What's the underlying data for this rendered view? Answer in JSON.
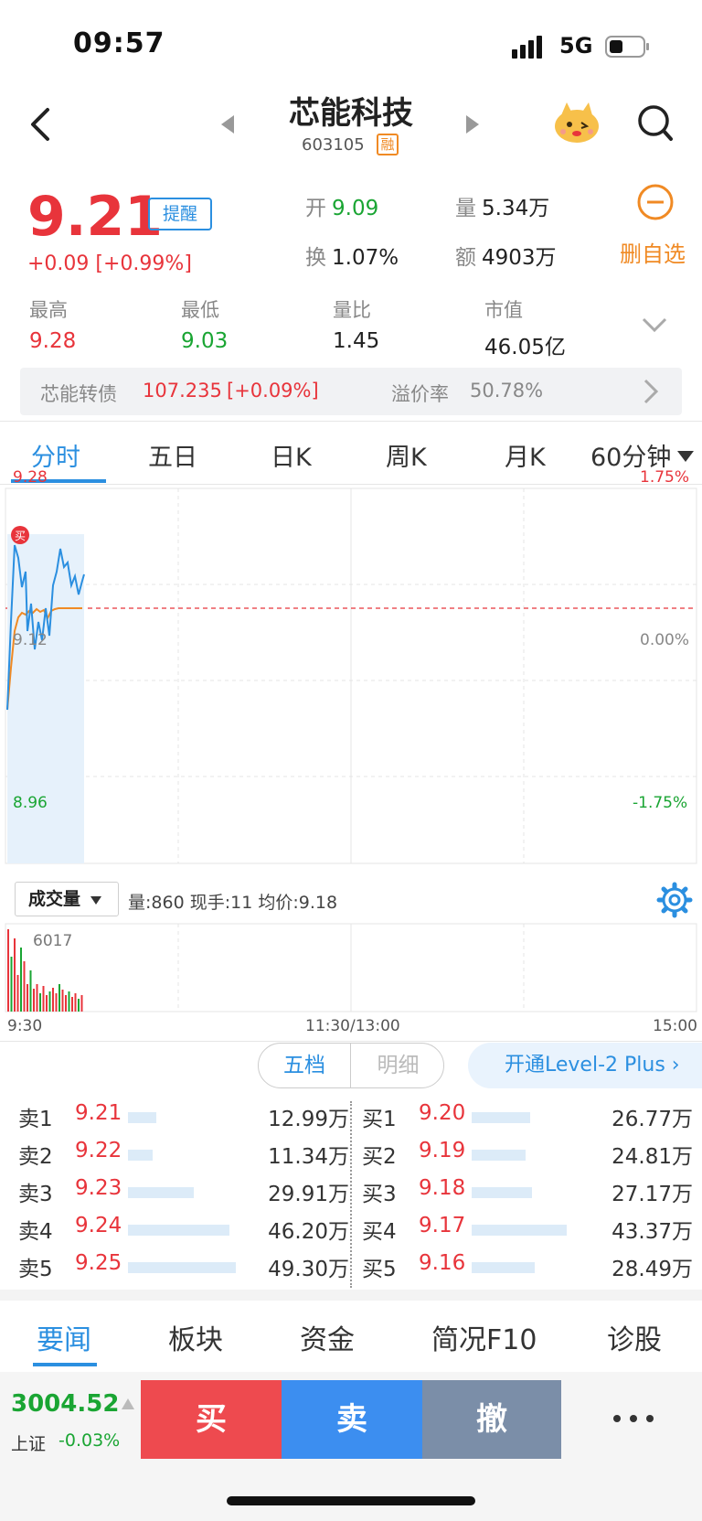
{
  "status_bar": {
    "time": "09:57",
    "network": "5G"
  },
  "header": {
    "stock_name": "芯能科技",
    "stock_code": "603105",
    "margin_tag": "融"
  },
  "quote": {
    "price": "9.21",
    "alert_label": "提醒",
    "change": "+0.09  [+0.99%]",
    "open_label": "开",
    "open_value": "9.09",
    "volume_label": "量",
    "volume_value": "5.34万",
    "turnover_label": "换",
    "turnover_value": "1.07%",
    "amount_label": "额",
    "amount_value": "4903万",
    "watchlist_remove_label": "删自选"
  },
  "stats": [
    {
      "label": "最高",
      "value": "9.28",
      "color": "#e8343b"
    },
    {
      "label": "最低",
      "value": "9.03",
      "color": "#1aa533"
    },
    {
      "label": "量比",
      "value": "1.45",
      "color": "#222222"
    },
    {
      "label": "市值",
      "value": "46.05亿",
      "color": "#222222"
    }
  ],
  "bond": {
    "name": "芯能转债",
    "price": "107.235",
    "change": "[+0.09%]",
    "premium_label": "溢价率",
    "premium_value": "50.78%"
  },
  "period_tabs": [
    "分时",
    "五日",
    "日K",
    "周K",
    "月K",
    "60分钟"
  ],
  "chart": {
    "y_max": "9.28",
    "y_mid": "9.12",
    "y_min": "8.96",
    "pct_max": "1.75%",
    "pct_mid": "0.00%",
    "pct_min": "-1.75%",
    "buy_marker": "买"
  },
  "chart_data": {
    "type": "line",
    "ylim": [
      8.96,
      9.28
    ],
    "reference_price": 9.12,
    "series": [],
    "volume_max_label": "6017"
  },
  "volume_panel": {
    "selector_label": "成交量",
    "info": "量:860  现手:11  均价:9.18"
  },
  "time_axis": {
    "start": "9:30",
    "mid": "11:30/13:00",
    "end": "15:00"
  },
  "depth": {
    "seg_five": "五档",
    "seg_detail": "明细",
    "level2": "开通Level-2 Plus",
    "asks": [
      {
        "label": "卖1",
        "price": "9.21",
        "volume": "12.99万",
        "ratio": 0.26
      },
      {
        "label": "卖2",
        "price": "9.22",
        "volume": "11.34万",
        "ratio": 0.23
      },
      {
        "label": "卖3",
        "price": "9.23",
        "volume": "29.91万",
        "ratio": 0.61
      },
      {
        "label": "卖4",
        "price": "9.24",
        "volume": "46.20万",
        "ratio": 0.94
      },
      {
        "label": "卖5",
        "price": "9.25",
        "volume": "49.30万",
        "ratio": 1.0
      }
    ],
    "bids": [
      {
        "label": "买1",
        "price": "9.20",
        "volume": "26.77万",
        "ratio": 0.62
      },
      {
        "label": "买2",
        "price": "9.19",
        "volume": "24.81万",
        "ratio": 0.57
      },
      {
        "label": "买3",
        "price": "9.18",
        "volume": "27.17万",
        "ratio": 0.63
      },
      {
        "label": "买4",
        "price": "9.17",
        "volume": "43.37万",
        "ratio": 1.0
      },
      {
        "label": "买5",
        "price": "9.16",
        "volume": "28.49万",
        "ratio": 0.66
      }
    ]
  },
  "news_tabs": [
    "要闻",
    "板块",
    "资金",
    "简况F10",
    "诊股"
  ],
  "bottom_bar": {
    "index_value": "3004.52",
    "index_name": "上证",
    "index_change": "-0.03%",
    "buy": "买",
    "sell": "卖",
    "cancel": "撤"
  }
}
